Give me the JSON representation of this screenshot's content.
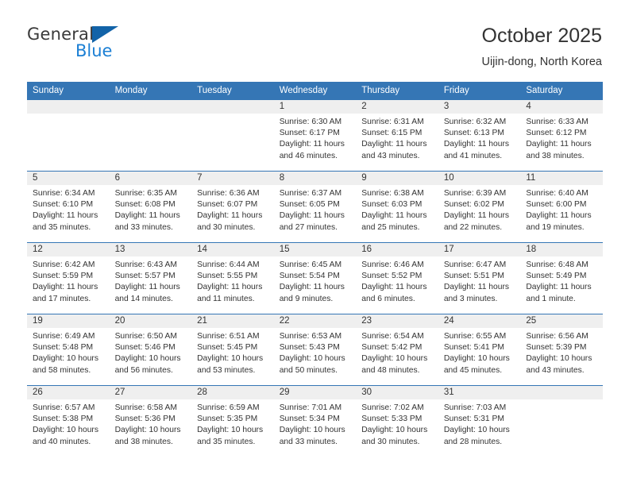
{
  "branding": {
    "logo_text_primary": "General",
    "logo_text_secondary": "Blue",
    "logo_triangle_color": "#1263a8",
    "logo_blue_color": "#1b7fd4"
  },
  "header": {
    "title": "October 2025",
    "subtitle": "Uijin-dong, North Korea"
  },
  "theme": {
    "header_blue": "#3576b5",
    "daynum_band": "#efefef",
    "text": "#333333"
  },
  "weekday_headers": [
    "Sunday",
    "Monday",
    "Tuesday",
    "Wednesday",
    "Thursday",
    "Friday",
    "Saturday"
  ],
  "weeks": [
    [
      {
        "day": "",
        "lines": []
      },
      {
        "day": "",
        "lines": []
      },
      {
        "day": "",
        "lines": []
      },
      {
        "day": "1",
        "lines": [
          "Sunrise: 6:30 AM",
          "Sunset: 6:17 PM",
          "Daylight: 11 hours",
          "and 46 minutes."
        ]
      },
      {
        "day": "2",
        "lines": [
          "Sunrise: 6:31 AM",
          "Sunset: 6:15 PM",
          "Daylight: 11 hours",
          "and 43 minutes."
        ]
      },
      {
        "day": "3",
        "lines": [
          "Sunrise: 6:32 AM",
          "Sunset: 6:13 PM",
          "Daylight: 11 hours",
          "and 41 minutes."
        ]
      },
      {
        "day": "4",
        "lines": [
          "Sunrise: 6:33 AM",
          "Sunset: 6:12 PM",
          "Daylight: 11 hours",
          "and 38 minutes."
        ]
      }
    ],
    [
      {
        "day": "5",
        "lines": [
          "Sunrise: 6:34 AM",
          "Sunset: 6:10 PM",
          "Daylight: 11 hours",
          "and 35 minutes."
        ]
      },
      {
        "day": "6",
        "lines": [
          "Sunrise: 6:35 AM",
          "Sunset: 6:08 PM",
          "Daylight: 11 hours",
          "and 33 minutes."
        ]
      },
      {
        "day": "7",
        "lines": [
          "Sunrise: 6:36 AM",
          "Sunset: 6:07 PM",
          "Daylight: 11 hours",
          "and 30 minutes."
        ]
      },
      {
        "day": "8",
        "lines": [
          "Sunrise: 6:37 AM",
          "Sunset: 6:05 PM",
          "Daylight: 11 hours",
          "and 27 minutes."
        ]
      },
      {
        "day": "9",
        "lines": [
          "Sunrise: 6:38 AM",
          "Sunset: 6:03 PM",
          "Daylight: 11 hours",
          "and 25 minutes."
        ]
      },
      {
        "day": "10",
        "lines": [
          "Sunrise: 6:39 AM",
          "Sunset: 6:02 PM",
          "Daylight: 11 hours",
          "and 22 minutes."
        ]
      },
      {
        "day": "11",
        "lines": [
          "Sunrise: 6:40 AM",
          "Sunset: 6:00 PM",
          "Daylight: 11 hours",
          "and 19 minutes."
        ]
      }
    ],
    [
      {
        "day": "12",
        "lines": [
          "Sunrise: 6:42 AM",
          "Sunset: 5:59 PM",
          "Daylight: 11 hours",
          "and 17 minutes."
        ]
      },
      {
        "day": "13",
        "lines": [
          "Sunrise: 6:43 AM",
          "Sunset: 5:57 PM",
          "Daylight: 11 hours",
          "and 14 minutes."
        ]
      },
      {
        "day": "14",
        "lines": [
          "Sunrise: 6:44 AM",
          "Sunset: 5:55 PM",
          "Daylight: 11 hours",
          "and 11 minutes."
        ]
      },
      {
        "day": "15",
        "lines": [
          "Sunrise: 6:45 AM",
          "Sunset: 5:54 PM",
          "Daylight: 11 hours",
          "and 9 minutes."
        ]
      },
      {
        "day": "16",
        "lines": [
          "Sunrise: 6:46 AM",
          "Sunset: 5:52 PM",
          "Daylight: 11 hours",
          "and 6 minutes."
        ]
      },
      {
        "day": "17",
        "lines": [
          "Sunrise: 6:47 AM",
          "Sunset: 5:51 PM",
          "Daylight: 11 hours",
          "and 3 minutes."
        ]
      },
      {
        "day": "18",
        "lines": [
          "Sunrise: 6:48 AM",
          "Sunset: 5:49 PM",
          "Daylight: 11 hours",
          "and 1 minute."
        ]
      }
    ],
    [
      {
        "day": "19",
        "lines": [
          "Sunrise: 6:49 AM",
          "Sunset: 5:48 PM",
          "Daylight: 10 hours",
          "and 58 minutes."
        ]
      },
      {
        "day": "20",
        "lines": [
          "Sunrise: 6:50 AM",
          "Sunset: 5:46 PM",
          "Daylight: 10 hours",
          "and 56 minutes."
        ]
      },
      {
        "day": "21",
        "lines": [
          "Sunrise: 6:51 AM",
          "Sunset: 5:45 PM",
          "Daylight: 10 hours",
          "and 53 minutes."
        ]
      },
      {
        "day": "22",
        "lines": [
          "Sunrise: 6:53 AM",
          "Sunset: 5:43 PM",
          "Daylight: 10 hours",
          "and 50 minutes."
        ]
      },
      {
        "day": "23",
        "lines": [
          "Sunrise: 6:54 AM",
          "Sunset: 5:42 PM",
          "Daylight: 10 hours",
          "and 48 minutes."
        ]
      },
      {
        "day": "24",
        "lines": [
          "Sunrise: 6:55 AM",
          "Sunset: 5:41 PM",
          "Daylight: 10 hours",
          "and 45 minutes."
        ]
      },
      {
        "day": "25",
        "lines": [
          "Sunrise: 6:56 AM",
          "Sunset: 5:39 PM",
          "Daylight: 10 hours",
          "and 43 minutes."
        ]
      }
    ],
    [
      {
        "day": "26",
        "lines": [
          "Sunrise: 6:57 AM",
          "Sunset: 5:38 PM",
          "Daylight: 10 hours",
          "and 40 minutes."
        ]
      },
      {
        "day": "27",
        "lines": [
          "Sunrise: 6:58 AM",
          "Sunset: 5:36 PM",
          "Daylight: 10 hours",
          "and 38 minutes."
        ]
      },
      {
        "day": "28",
        "lines": [
          "Sunrise: 6:59 AM",
          "Sunset: 5:35 PM",
          "Daylight: 10 hours",
          "and 35 minutes."
        ]
      },
      {
        "day": "29",
        "lines": [
          "Sunrise: 7:01 AM",
          "Sunset: 5:34 PM",
          "Daylight: 10 hours",
          "and 33 minutes."
        ]
      },
      {
        "day": "30",
        "lines": [
          "Sunrise: 7:02 AM",
          "Sunset: 5:33 PM",
          "Daylight: 10 hours",
          "and 30 minutes."
        ]
      },
      {
        "day": "31",
        "lines": [
          "Sunrise: 7:03 AM",
          "Sunset: 5:31 PM",
          "Daylight: 10 hours",
          "and 28 minutes."
        ]
      },
      {
        "day": "",
        "lines": []
      }
    ]
  ]
}
